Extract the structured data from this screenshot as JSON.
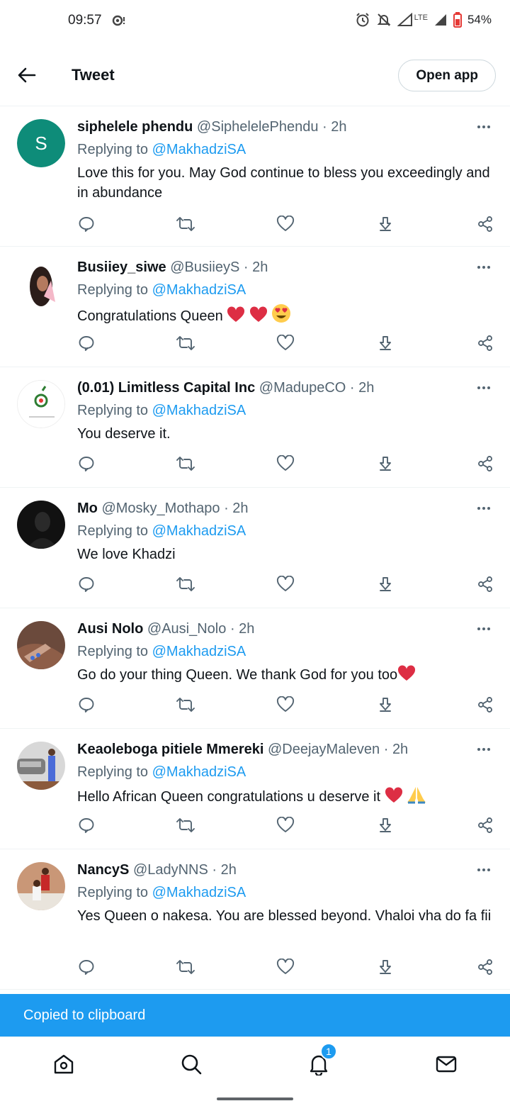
{
  "status_bar": {
    "time": "09:57",
    "battery": "54%",
    "network": "LTE"
  },
  "header": {
    "title": "Tweet",
    "open_app_label": "Open app"
  },
  "replying_label": "Replying to",
  "tweets": [
    {
      "name": "siphelele phendu",
      "handle": "@SiphelelePhendu",
      "dot": "·",
      "time": "2h",
      "reply_to": "@MakhadziSA",
      "text": "Love this for you. May God continue to bless you exceedingly and in abundance",
      "avatar_letter": "S"
    },
    {
      "name": "Busiiey_siwe",
      "handle": "@BusiieyS",
      "dot": "·",
      "time": "2h",
      "reply_to": "@MakhadziSA",
      "text": "Congratulations Queen "
    },
    {
      "name": "(0.01) Limitless Capital Inc",
      "handle": "@MadupeCO",
      "dot": "·",
      "time": "2h",
      "reply_to": "@MakhadziSA",
      "text": "You deserve it."
    },
    {
      "name": "Mo",
      "handle": "@Mosky_Mothapo",
      "dot": "·",
      "time": "2h",
      "reply_to": "@MakhadziSA",
      "text": "We love Khadzi"
    },
    {
      "name": "Ausi Nolo",
      "handle": "@Ausi_Nolo",
      "dot": "·",
      "time": "2h",
      "reply_to": "@MakhadziSA",
      "text": "Go do your thing Queen. We thank God for you too"
    },
    {
      "name": "Keaoleboga pitiele Mmereki",
      "handle": "@DeejayMaleven",
      "dot": "·",
      "time": "2h",
      "reply_to": "@MakhadziSA",
      "text": "Hello African Queen congratulations u deserve it "
    },
    {
      "name": "NancyS",
      "handle": "@LadyNNS",
      "dot": "·",
      "time": "2h",
      "reply_to": "@MakhadziSA",
      "text": "Yes Queen o nakesa. You are blessed beyond. Vhaloi vha do fa fii"
    }
  ],
  "toast": {
    "text": "Copied to clipboard"
  },
  "bottom_nav": {
    "notification_count": "1"
  },
  "colors": {
    "accent": "#1d9bf0",
    "text": "#0f1419",
    "muted": "#536471"
  }
}
